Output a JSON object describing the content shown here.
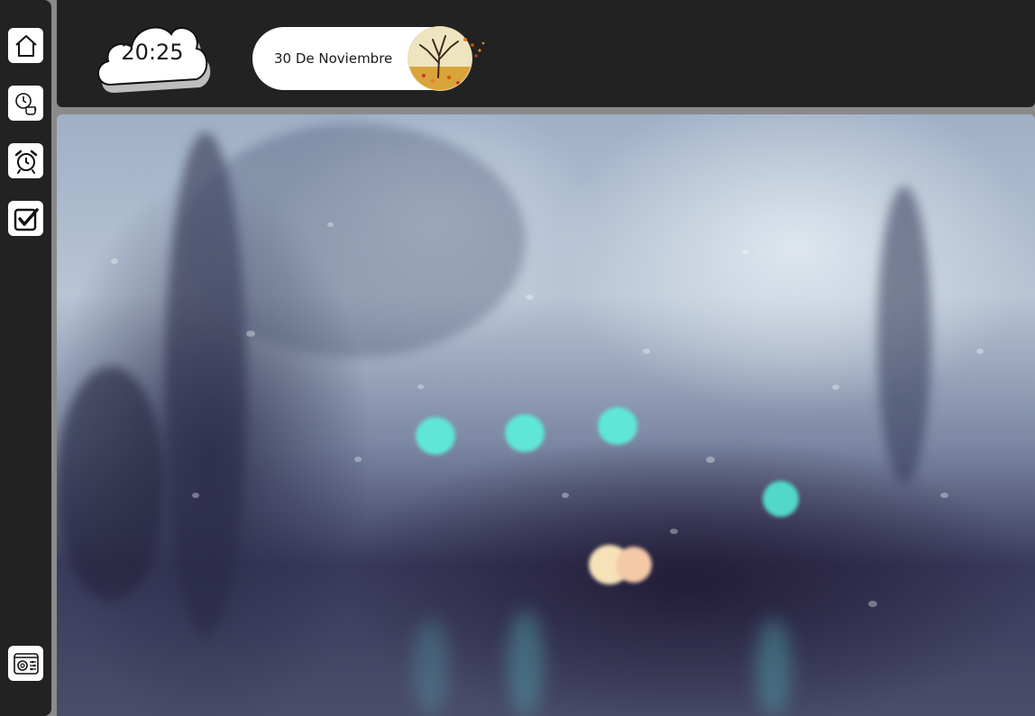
{
  "clock": {
    "time": "20:25"
  },
  "date": {
    "label": "30 De Noviembre"
  },
  "sidebar": {
    "items": [
      {
        "icon": "home-icon"
      },
      {
        "icon": "clock-coffee-icon"
      },
      {
        "icon": "alarm-clock-icon"
      },
      {
        "icon": "checkbox-icon"
      }
    ],
    "bottom_item": {
      "icon": "settings-panel-icon"
    }
  },
  "colors": {
    "panel": "#222222",
    "button_bg": "#ffffff",
    "accent_light": "#5ee8d8",
    "warm_light": "#f7e2b8"
  }
}
